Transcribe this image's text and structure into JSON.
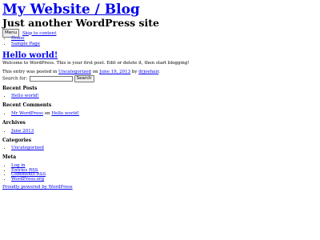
{
  "header": {
    "site_title": "My Website / Blog",
    "site_description": "Just another WordPress site"
  },
  "nav": {
    "menu_button": "Menu",
    "skip_link": "Skip to content",
    "items": [
      {
        "label": "Home"
      },
      {
        "label": "Sample Page"
      }
    ]
  },
  "post": {
    "title": "Hello world!",
    "content": "Welcome to WordPress. This is your first post. Edit or delete it, then start blogging!",
    "meta_prefix": "This entry was posted in ",
    "category": "Uncategorized",
    "meta_on": " on ",
    "date": "June 19, 2013",
    "meta_by": " by ",
    "author": "drjoehair",
    "meta_end": "."
  },
  "search": {
    "label": "Search for:",
    "value": "",
    "button": "Search"
  },
  "sidebar": {
    "recent_posts": {
      "title": "Recent Posts",
      "items": [
        "Hello world!"
      ]
    },
    "recent_comments": {
      "title": "Recent Comments",
      "commenter": "Mr WordPress",
      "on": " on ",
      "post": "Hello world!"
    },
    "archives": {
      "title": "Archives",
      "items": [
        "June 2013"
      ]
    },
    "categories": {
      "title": "Categories",
      "items": [
        "Uncategorized"
      ]
    },
    "meta": {
      "title": "Meta",
      "items": [
        "Log in",
        "Entries RSS",
        "Comments RSS",
        "WordPress.org"
      ]
    }
  },
  "footer": {
    "text": "Proudly powered by WordPress"
  },
  "colors": {
    "link": "#0000ee",
    "text": "#000000",
    "background": "#ffffff"
  }
}
